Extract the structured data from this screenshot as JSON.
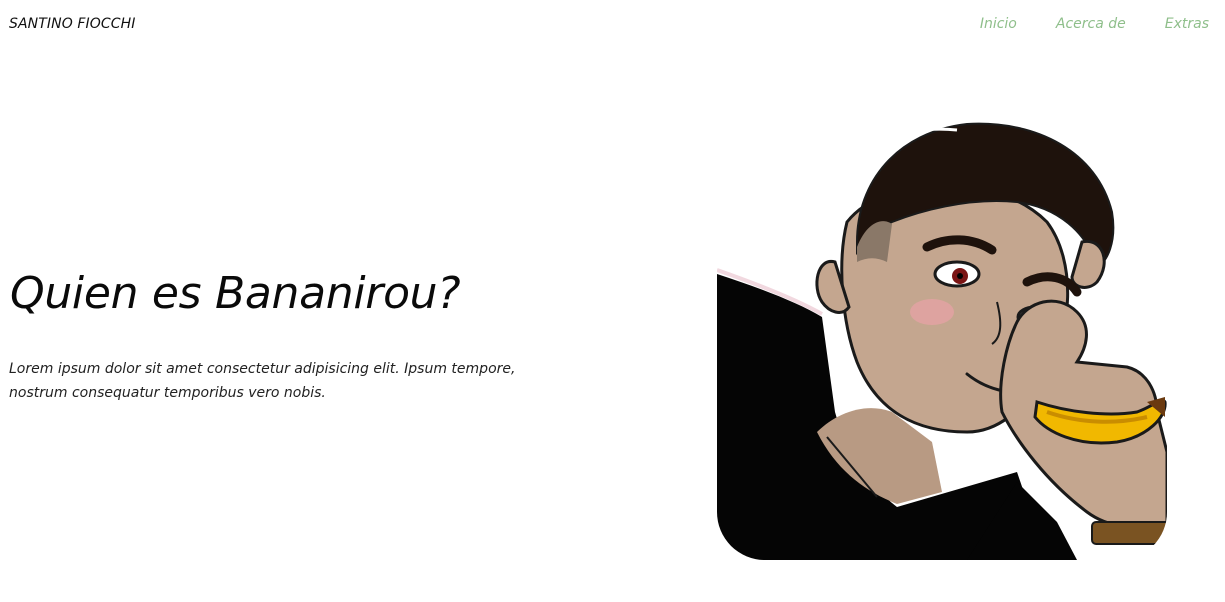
{
  "header": {
    "brand": "SANTINO FIOCCHI",
    "nav": [
      {
        "label": "Inicio"
      },
      {
        "label": "Acerca de"
      },
      {
        "label": "Extras"
      }
    ],
    "nav_color": "#8fbf8b"
  },
  "hero": {
    "title": "Quien es Bananirou?",
    "text": "Lorem ipsum dolor sit amet consectetur adipisicing elit. Ipsum tempore, nostrum consequatur temporibus vero nobis."
  }
}
